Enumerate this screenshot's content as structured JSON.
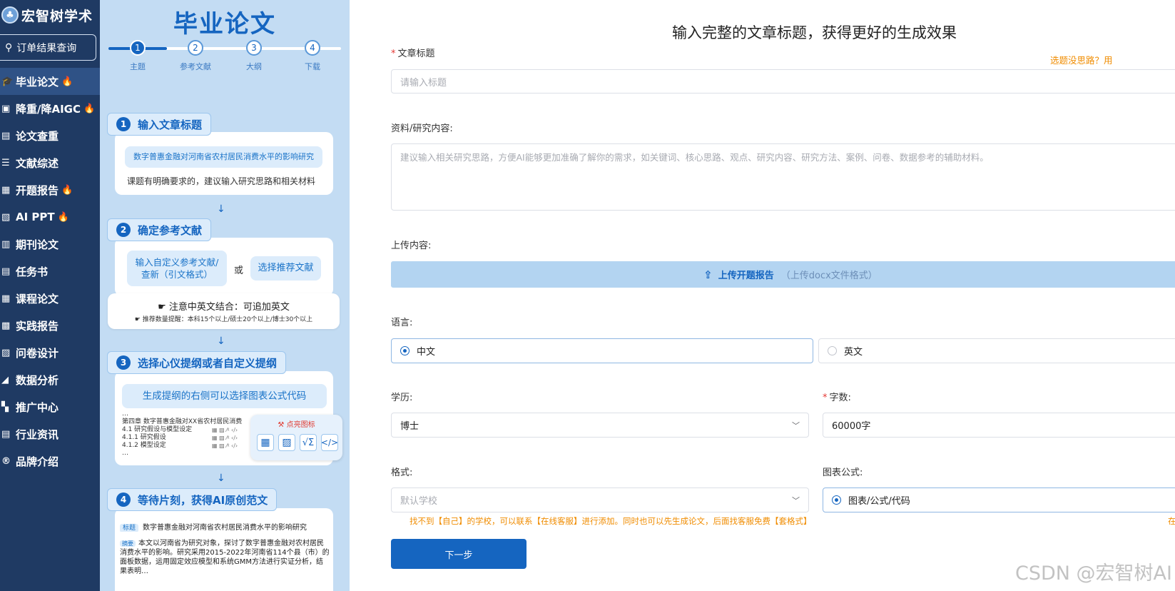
{
  "brand": {
    "logo_icon": "tree-logo",
    "name": "宏智树学术"
  },
  "order_query": {
    "icon": "search-icon",
    "label": "订单结果查询"
  },
  "nav": [
    {
      "icon": "graduation-cap-icon",
      "glyph": "🎓",
      "label": "毕业论文",
      "hot": true,
      "active": true
    },
    {
      "icon": "card-icon",
      "glyph": "▣",
      "label": "降重/降AIGC",
      "hot": true
    },
    {
      "icon": "doc-check-icon",
      "glyph": "▤",
      "label": "论文查重"
    },
    {
      "icon": "list-icon",
      "glyph": "☰",
      "label": "文献综述"
    },
    {
      "icon": "report-icon",
      "glyph": "▦",
      "label": "开题报告",
      "hot": true
    },
    {
      "icon": "ppt-icon",
      "glyph": "▧",
      "label": "AI PPT",
      "hot": true
    },
    {
      "icon": "journal-icon",
      "glyph": "▥",
      "label": "期刊论文"
    },
    {
      "icon": "task-icon",
      "glyph": "▤",
      "label": "任务书"
    },
    {
      "icon": "course-icon",
      "glyph": "▦",
      "label": "课程论文"
    },
    {
      "icon": "practice-icon",
      "glyph": "▩",
      "label": "实践报告"
    },
    {
      "icon": "survey-icon",
      "glyph": "▨",
      "label": "问卷设计"
    },
    {
      "icon": "chart-icon",
      "glyph": "◢",
      "label": "数据分析"
    },
    {
      "icon": "grid-icon",
      "glyph": "▚",
      "label": "推广中心"
    },
    {
      "icon": "news-icon",
      "glyph": "▤",
      "label": "行业资讯"
    },
    {
      "icon": "registered-icon",
      "glyph": "®",
      "label": "品牌介绍"
    }
  ],
  "hot_icon": "fire-icon",
  "guide": {
    "title": "毕业论文",
    "steps": [
      {
        "num": "1",
        "label": "主题"
      },
      {
        "num": "2",
        "label": "参考文献"
      },
      {
        "num": "3",
        "label": "大纲"
      },
      {
        "num": "4",
        "label": "下载"
      }
    ],
    "sec1": {
      "num": "1",
      "title": "输入文章标题",
      "example": "数字普惠金融对河南省农村居民消费水平的影响研究",
      "note": "课题有明确要求的，建议输入研究思路和相关材料"
    },
    "sec2": {
      "num": "2",
      "title": "确定参考文献",
      "custom": "输入自定义参考文献/查新（引文格式）",
      "or": "或",
      "recommend": "选择推荐文献",
      "tip": "注意中英文结合：可追加英文",
      "tip_small": "推荐数量提醒：本科15个以上/硕士20个以上/博士30个以上"
    },
    "sec3": {
      "num": "3",
      "title": "选择心仪提纲或者自定义提纲",
      "hint": "生成提纲的右侧可以选择图表公式代码",
      "outline": [
        "…",
        "第四章 数字普惠金融对XX省农村居民消费",
        "4.1 研究假设与模型设定",
        "4.1.1 研究假设",
        "4.1.2 模型设定",
        "…"
      ],
      "popup_title": "点亮图标",
      "popup_icons": [
        "table-icon",
        "image-icon",
        "formula-icon",
        "code-icon"
      ]
    },
    "sec4": {
      "num": "4",
      "title": "等待片刻，获得AI原创范文",
      "tag_title": "标题",
      "paper_title": "数字普惠金融对河南省农村居民消费水平的影响研究",
      "tag_abstract": "摘要",
      "abstract": "本文以河南省为研究对象，探讨了数字普惠金融对农村居民消费水平的影响。研究采用2015-2022年河南省114个县（市）的面板数据，运用固定效应模型和系统GMM方法进行实证分析，结果表明…"
    }
  },
  "form": {
    "headline": "输入完整的文章标题，获得更好的生成效果",
    "title_label": "文章标题",
    "title_placeholder": "请输入标题",
    "topic_hint": "选题没思路？用",
    "material_label": "资料/研究内容:",
    "material_placeholder": "建议输入相关研究思路，方便AI能够更加准确了解你的需求，如关键词、核心思路、观点、研究内容、研究方法、案例、问卷、数据参考的辅助材料。",
    "upload_label": "上传内容:",
    "upload_button": "上传开题报告",
    "upload_hint": "（上传docx文件格式）",
    "language_label": "语言:",
    "lang_zh": "中文",
    "lang_en": "英文",
    "degree_label": "学历:",
    "degree_value": "博士",
    "words_label": "字数:",
    "words_value": "60000字",
    "format_label": "格式:",
    "format_placeholder": "默认学校",
    "chart_label": "图表公式:",
    "chart_option": "图表/公式/代码",
    "format_hint": "找不到【自己】的学校，可以联系【在线客服】进行添加。同时也可以先生成论文，后面找客服免费【套格式】",
    "right_hint": "在",
    "next_button": "下一步"
  },
  "watermark": "CSDN @宏智树AI"
}
